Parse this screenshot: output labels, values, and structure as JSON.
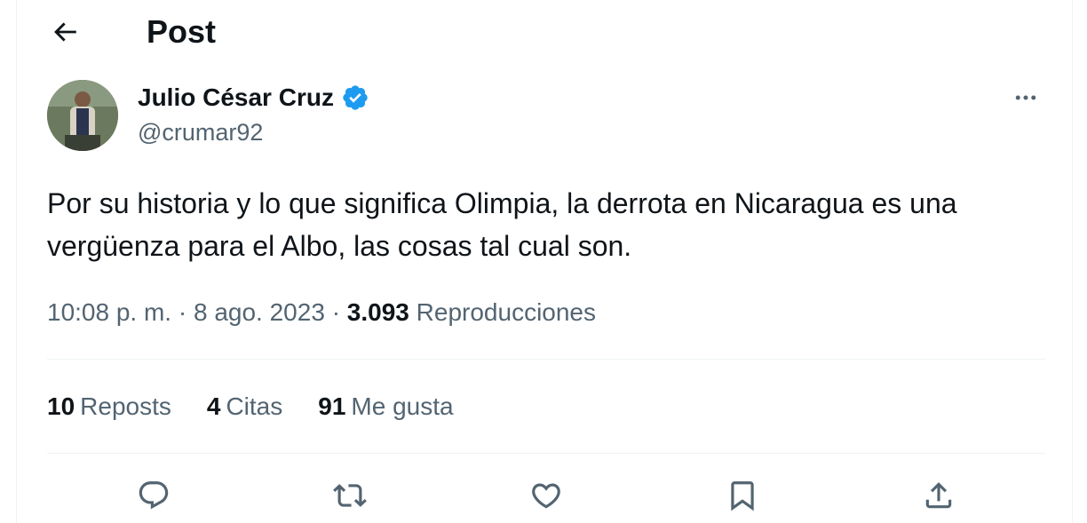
{
  "header": {
    "title": "Post"
  },
  "tweet": {
    "author": {
      "display_name": "Julio César Cruz",
      "handle": "@crumar92",
      "verified": true
    },
    "text_line1": "Por su historia y lo que significa Olimpia, la derrota en Nicaragua es una",
    "text_line2": "vergüenza para el Albo, las cosas tal cual son.",
    "time": "10:08 p. m.",
    "separator": "·",
    "date": "8 ago. 2023",
    "views_count": "3.093",
    "views_label": "Reproducciones"
  },
  "stats": {
    "reposts_count": "10",
    "reposts_label": "Reposts",
    "quotes_count": "4",
    "quotes_label": "Citas",
    "likes_count": "91",
    "likes_label": "Me gusta"
  },
  "colors": {
    "text_primary": "#0f1419",
    "text_secondary": "#536471",
    "verified_blue": "#1d9bf0",
    "divider": "#eff3f4"
  },
  "icons": {
    "back": "arrow-left-icon",
    "verified": "verified-badge-icon",
    "more": "more-icon",
    "reply": "reply-icon",
    "repost": "repost-icon",
    "like": "heart-icon",
    "bookmark": "bookmark-icon",
    "share": "share-icon"
  }
}
